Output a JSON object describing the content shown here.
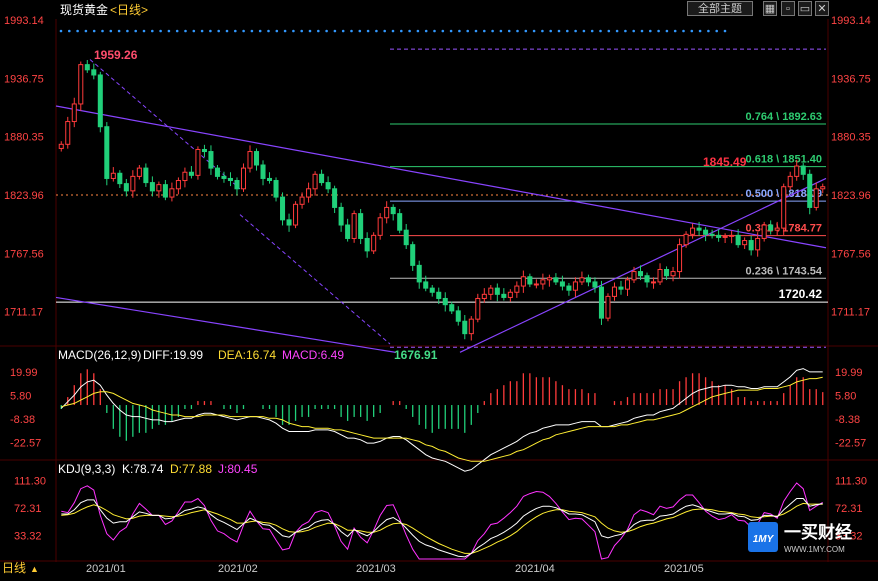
{
  "header": {
    "title_prefix": "现货黄金",
    "title_bracket": "<日线>",
    "theme_button": "全部主题",
    "close_icon": "close-icon"
  },
  "panels": {
    "main": {
      "y_ticks": [
        "1993.14",
        "1936.75",
        "1880.35",
        "1823.96",
        "1767.56",
        "1711.17"
      ],
      "high_label": "1959.26",
      "low_label": "1676.91",
      "last_label": "1845.49",
      "hline_label": "1720.42",
      "fib": [
        {
          "label": "0.764 \\ 1892.63",
          "value": 1892.63,
          "color": "#2ecc71"
        },
        {
          "label": "0.618 \\ 1851.40",
          "value": 1851.4,
          "color": "#2ecc71"
        },
        {
          "label": "0.500 \\ 1818.09",
          "value": 1818.09,
          "color": "#8aa7ff"
        },
        {
          "label": "0.382 \\ 1784.77",
          "value": 1784.77,
          "color": "#ff4d4d"
        },
        {
          "label": "0.236 \\ 1743.54",
          "value": 1743.54,
          "color": "#bbbbbb"
        }
      ]
    },
    "macd": {
      "label_name": "MACD(26,12,9)",
      "diff": "DIFF:19.99",
      "dea": "DEA:16.74",
      "macd": "MACD:6.49",
      "y_ticks": [
        "19.99",
        "5.80",
        "-8.38",
        "-22.57"
      ]
    },
    "kdj": {
      "label_name": "KDJ(9,3,3)",
      "k": "K:78.74",
      "d": "D:77.88",
      "j": "J:80.45",
      "y_ticks": [
        "111.30",
        "72.31",
        "33.32"
      ]
    }
  },
  "x_axis": {
    "label": "日线",
    "months": [
      "2021/01",
      "2021/02",
      "2021/03",
      "2021/04",
      "2021/05"
    ]
  },
  "logo": {
    "brand": "一买财经",
    "url": "WWW.1MY.COM",
    "mark": "1MY"
  },
  "chart_data": {
    "type": "candlestick",
    "y_range": [
      1680,
      1993.14
    ],
    "macd_range": [
      -32,
      26
    ],
    "kdj_range": [
      0,
      118
    ],
    "last_close": 1823.96,
    "close": [
      1873,
      1895,
      1912,
      1950,
      1945,
      1940,
      1890,
      1840,
      1845,
      1835,
      1828,
      1842,
      1850,
      1836,
      1828,
      1834,
      1822,
      1830,
      1838,
      1846,
      1843,
      1868,
      1866,
      1850,
      1842,
      1840,
      1838,
      1830,
      1850,
      1866,
      1853,
      1840,
      1838,
      1822,
      1800,
      1795,
      1815,
      1822,
      1830,
      1844,
      1836,
      1830,
      1812,
      1795,
      1782,
      1806,
      1782,
      1770,
      1785,
      1802,
      1812,
      1806,
      1790,
      1776,
      1756,
      1740,
      1734,
      1730,
      1724,
      1718,
      1712,
      1702,
      1690,
      1704,
      1724,
      1728,
      1734,
      1728,
      1725,
      1730,
      1736,
      1745,
      1738,
      1738,
      1742,
      1744,
      1740,
      1736,
      1732,
      1740,
      1744,
      1740,
      1735,
      1705,
      1726,
      1735,
      1733,
      1742,
      1750,
      1746,
      1740,
      1740,
      1752,
      1746,
      1750,
      1776,
      1786,
      1792,
      1790,
      1786,
      1785,
      1783,
      1784,
      1785,
      1776,
      1780,
      1771,
      1782,
      1795,
      1790,
      1792,
      1832,
      1842,
      1852,
      1844,
      1812,
      1830,
      1832
    ],
    "kdj_k": [
      64,
      64,
      70,
      80,
      84,
      84,
      70,
      58,
      51,
      53,
      53,
      60,
      67,
      65,
      62,
      62,
      57,
      58,
      63,
      69,
      71,
      74,
      72,
      63,
      56,
      52,
      47,
      42,
      50,
      58,
      54,
      49,
      48,
      41,
      33,
      31,
      38,
      42,
      45,
      52,
      55,
      56,
      49,
      39,
      32,
      42,
      37,
      33,
      39,
      48,
      56,
      59,
      53,
      44,
      34,
      25,
      20,
      17,
      13,
      10,
      7,
      4,
      3,
      8,
      16,
      22,
      29,
      33,
      38,
      44,
      51,
      61,
      67,
      72,
      75,
      75,
      73,
      69,
      64,
      64,
      63,
      58,
      53,
      33,
      30,
      33,
      35,
      40,
      49,
      54,
      55,
      55,
      61,
      62,
      64,
      70,
      75,
      77,
      74,
      70,
      67,
      64,
      64,
      65,
      61,
      60,
      55,
      56,
      62,
      62,
      60,
      70,
      78,
      86,
      86,
      75,
      77,
      78.74
    ],
    "kdj_d": [
      62,
      63,
      65,
      70,
      74,
      77,
      74,
      69,
      63,
      60,
      57,
      58,
      61,
      62,
      62,
      62,
      61,
      60,
      61,
      63,
      66,
      68,
      70,
      67,
      64,
      60,
      56,
      51,
      51,
      53,
      54,
      52,
      51,
      48,
      43,
      39,
      38,
      39,
      41,
      45,
      48,
      51,
      50,
      46,
      41,
      41,
      40,
      38,
      38,
      41,
      46,
      50,
      51,
      49,
      44,
      38,
      32,
      27,
      22,
      18,
      14,
      11,
      8,
      8,
      11,
      15,
      19,
      24,
      28,
      33,
      39,
      47,
      54,
      60,
      65,
      68,
      70,
      70,
      68,
      67,
      66,
      63,
      60,
      51,
      44,
      40,
      38,
      39,
      42,
      46,
      49,
      51,
      54,
      57,
      59,
      63,
      67,
      70,
      71,
      71,
      70,
      68,
      67,
      66,
      64,
      63,
      60,
      59,
      60,
      61,
      61,
      64,
      69,
      75,
      79,
      78,
      78,
      77.88
    ],
    "macd_dif": [
      -2,
      2,
      6,
      11,
      14,
      15,
      12,
      6,
      1,
      -3,
      -6,
      -7,
      -7,
      -8,
      -9,
      -9,
      -10,
      -10,
      -9,
      -8,
      -8,
      -6,
      -5,
      -5,
      -6,
      -7,
      -8,
      -9,
      -8,
      -7,
      -7,
      -8,
      -9,
      -11,
      -14,
      -16,
      -16,
      -16,
      -16,
      -15,
      -15,
      -15,
      -16,
      -18,
      -20,
      -20,
      -21,
      -23,
      -23,
      -22,
      -20,
      -19,
      -19,
      -21,
      -24,
      -27,
      -30,
      -32,
      -33,
      -34,
      -36,
      -38,
      -40,
      -39,
      -36,
      -33,
      -30,
      -28,
      -26,
      -24,
      -22,
      -19,
      -17,
      -16,
      -14,
      -13,
      -12,
      -12,
      -12,
      -11,
      -10,
      -10,
      -10,
      -13,
      -13,
      -12,
      -11,
      -10,
      -8,
      -7,
      -6,
      -6,
      -4,
      -3,
      -2,
      1,
      4,
      7,
      9,
      10,
      11,
      11,
      12,
      12,
      11,
      11,
      10,
      10,
      11,
      11,
      11,
      14,
      17,
      21,
      22,
      20,
      20,
      19.99
    ],
    "macd_dea": [
      -1,
      0,
      1,
      3,
      5,
      7,
      8,
      8,
      7,
      5,
      3,
      1,
      0,
      -1,
      -3,
      -4,
      -5,
      -6,
      -6,
      -7,
      -7,
      -7,
      -6,
      -6,
      -6,
      -6,
      -7,
      -7,
      -7,
      -7,
      -7,
      -7,
      -8,
      -8,
      -9,
      -11,
      -12,
      -13,
      -13,
      -14,
      -14,
      -14,
      -15,
      -15,
      -16,
      -17,
      -18,
      -19,
      -20,
      -20,
      -20,
      -20,
      -20,
      -20,
      -21,
      -22,
      -24,
      -25,
      -27,
      -28,
      -30,
      -32,
      -33,
      -34,
      -34,
      -34,
      -33,
      -32,
      -31,
      -30,
      -28,
      -27,
      -25,
      -23,
      -21,
      -20,
      -18,
      -17,
      -16,
      -15,
      -14,
      -13,
      -13,
      -13,
      -13,
      -13,
      -12,
      -12,
      -11,
      -10,
      -9,
      -9,
      -8,
      -7,
      -6,
      -5,
      -3,
      -1,
      1,
      3,
      5,
      6,
      7,
      8,
      9,
      9,
      9,
      9,
      10,
      10,
      10,
      11,
      12,
      14,
      15,
      16,
      16,
      16.74
    ],
    "hist_scale": 2.4
  }
}
